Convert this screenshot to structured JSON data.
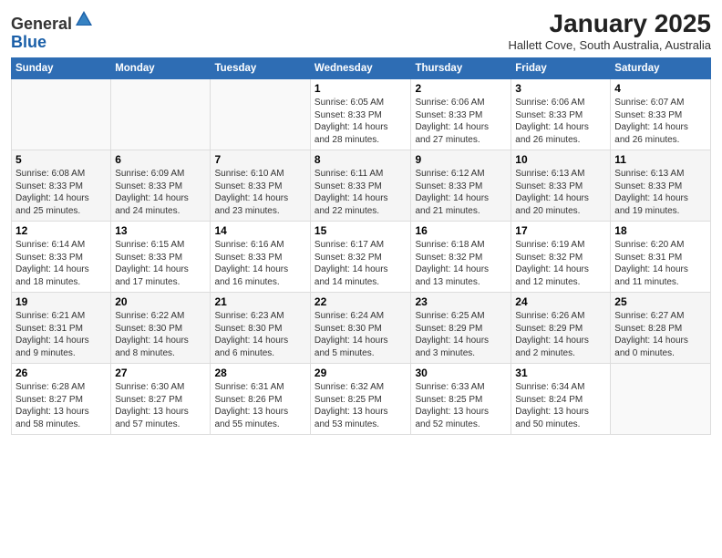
{
  "header": {
    "logo_general": "General",
    "logo_blue": "Blue",
    "month": "January 2025",
    "location": "Hallett Cove, South Australia, Australia"
  },
  "weekdays": [
    "Sunday",
    "Monday",
    "Tuesday",
    "Wednesday",
    "Thursday",
    "Friday",
    "Saturday"
  ],
  "weeks": [
    [
      {
        "day": "",
        "info": ""
      },
      {
        "day": "",
        "info": ""
      },
      {
        "day": "",
        "info": ""
      },
      {
        "day": "1",
        "info": "Sunrise: 6:05 AM\nSunset: 8:33 PM\nDaylight: 14 hours\nand 28 minutes."
      },
      {
        "day": "2",
        "info": "Sunrise: 6:06 AM\nSunset: 8:33 PM\nDaylight: 14 hours\nand 27 minutes."
      },
      {
        "day": "3",
        "info": "Sunrise: 6:06 AM\nSunset: 8:33 PM\nDaylight: 14 hours\nand 26 minutes."
      },
      {
        "day": "4",
        "info": "Sunrise: 6:07 AM\nSunset: 8:33 PM\nDaylight: 14 hours\nand 26 minutes."
      }
    ],
    [
      {
        "day": "5",
        "info": "Sunrise: 6:08 AM\nSunset: 8:33 PM\nDaylight: 14 hours\nand 25 minutes."
      },
      {
        "day": "6",
        "info": "Sunrise: 6:09 AM\nSunset: 8:33 PM\nDaylight: 14 hours\nand 24 minutes."
      },
      {
        "day": "7",
        "info": "Sunrise: 6:10 AM\nSunset: 8:33 PM\nDaylight: 14 hours\nand 23 minutes."
      },
      {
        "day": "8",
        "info": "Sunrise: 6:11 AM\nSunset: 8:33 PM\nDaylight: 14 hours\nand 22 minutes."
      },
      {
        "day": "9",
        "info": "Sunrise: 6:12 AM\nSunset: 8:33 PM\nDaylight: 14 hours\nand 21 minutes."
      },
      {
        "day": "10",
        "info": "Sunrise: 6:13 AM\nSunset: 8:33 PM\nDaylight: 14 hours\nand 20 minutes."
      },
      {
        "day": "11",
        "info": "Sunrise: 6:13 AM\nSunset: 8:33 PM\nDaylight: 14 hours\nand 19 minutes."
      }
    ],
    [
      {
        "day": "12",
        "info": "Sunrise: 6:14 AM\nSunset: 8:33 PM\nDaylight: 14 hours\nand 18 minutes."
      },
      {
        "day": "13",
        "info": "Sunrise: 6:15 AM\nSunset: 8:33 PM\nDaylight: 14 hours\nand 17 minutes."
      },
      {
        "day": "14",
        "info": "Sunrise: 6:16 AM\nSunset: 8:33 PM\nDaylight: 14 hours\nand 16 minutes."
      },
      {
        "day": "15",
        "info": "Sunrise: 6:17 AM\nSunset: 8:32 PM\nDaylight: 14 hours\nand 14 minutes."
      },
      {
        "day": "16",
        "info": "Sunrise: 6:18 AM\nSunset: 8:32 PM\nDaylight: 14 hours\nand 13 minutes."
      },
      {
        "day": "17",
        "info": "Sunrise: 6:19 AM\nSunset: 8:32 PM\nDaylight: 14 hours\nand 12 minutes."
      },
      {
        "day": "18",
        "info": "Sunrise: 6:20 AM\nSunset: 8:31 PM\nDaylight: 14 hours\nand 11 minutes."
      }
    ],
    [
      {
        "day": "19",
        "info": "Sunrise: 6:21 AM\nSunset: 8:31 PM\nDaylight: 14 hours\nand 9 minutes."
      },
      {
        "day": "20",
        "info": "Sunrise: 6:22 AM\nSunset: 8:30 PM\nDaylight: 14 hours\nand 8 minutes."
      },
      {
        "day": "21",
        "info": "Sunrise: 6:23 AM\nSunset: 8:30 PM\nDaylight: 14 hours\nand 6 minutes."
      },
      {
        "day": "22",
        "info": "Sunrise: 6:24 AM\nSunset: 8:30 PM\nDaylight: 14 hours\nand 5 minutes."
      },
      {
        "day": "23",
        "info": "Sunrise: 6:25 AM\nSunset: 8:29 PM\nDaylight: 14 hours\nand 3 minutes."
      },
      {
        "day": "24",
        "info": "Sunrise: 6:26 AM\nSunset: 8:29 PM\nDaylight: 14 hours\nand 2 minutes."
      },
      {
        "day": "25",
        "info": "Sunrise: 6:27 AM\nSunset: 8:28 PM\nDaylight: 14 hours\nand 0 minutes."
      }
    ],
    [
      {
        "day": "26",
        "info": "Sunrise: 6:28 AM\nSunset: 8:27 PM\nDaylight: 13 hours\nand 58 minutes."
      },
      {
        "day": "27",
        "info": "Sunrise: 6:30 AM\nSunset: 8:27 PM\nDaylight: 13 hours\nand 57 minutes."
      },
      {
        "day": "28",
        "info": "Sunrise: 6:31 AM\nSunset: 8:26 PM\nDaylight: 13 hours\nand 55 minutes."
      },
      {
        "day": "29",
        "info": "Sunrise: 6:32 AM\nSunset: 8:25 PM\nDaylight: 13 hours\nand 53 minutes."
      },
      {
        "day": "30",
        "info": "Sunrise: 6:33 AM\nSunset: 8:25 PM\nDaylight: 13 hours\nand 52 minutes."
      },
      {
        "day": "31",
        "info": "Sunrise: 6:34 AM\nSunset: 8:24 PM\nDaylight: 13 hours\nand 50 minutes."
      },
      {
        "day": "",
        "info": ""
      }
    ]
  ]
}
